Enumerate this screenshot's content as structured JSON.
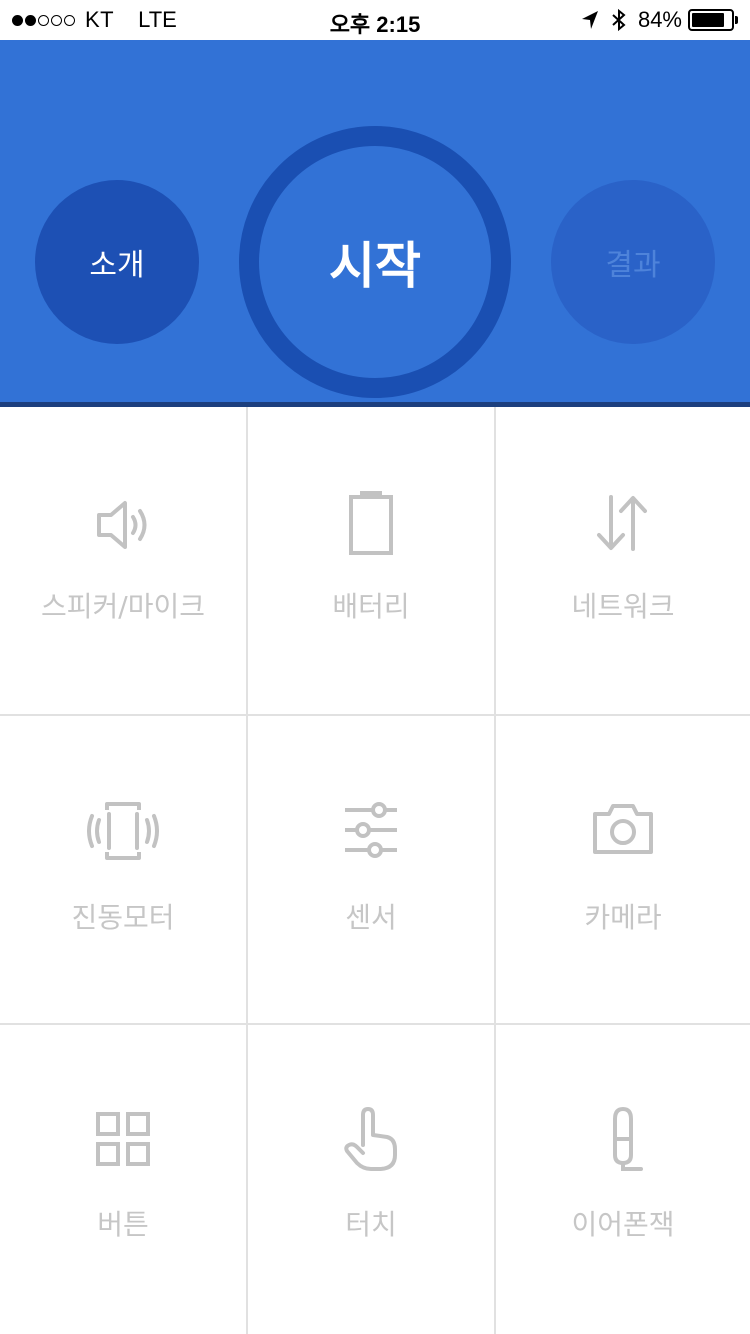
{
  "status_bar": {
    "carrier": "KT",
    "network": "LTE",
    "time": "오후 2:15",
    "battery_percent": "84%",
    "battery_level": 0.84,
    "signal_bars_filled": 2,
    "signal_bars_total": 5,
    "icons": [
      "location-arrow-icon",
      "bluetooth-icon",
      "battery-icon"
    ]
  },
  "header": {
    "colors": {
      "background": "#3272d6",
      "intro_circle": "#1d50b4",
      "start_ring": "#1a4fb2",
      "result_circle": "#2a62c8"
    },
    "intro_label": "소개",
    "start_label": "시작",
    "result_label": "결과"
  },
  "grid": {
    "label_color": "#c6c6c6",
    "items": [
      {
        "label": "스피커/마이크",
        "icon": "speaker-icon"
      },
      {
        "label": "배터리",
        "icon": "battery-icon"
      },
      {
        "label": "네트워크",
        "icon": "network-arrows-icon"
      },
      {
        "label": "진동모터",
        "icon": "vibration-icon"
      },
      {
        "label": "센서",
        "icon": "sliders-icon"
      },
      {
        "label": "카메라",
        "icon": "camera-icon"
      },
      {
        "label": "버튼",
        "icon": "grid-buttons-icon"
      },
      {
        "label": "터치",
        "icon": "touch-hand-icon"
      },
      {
        "label": "이어폰잭",
        "icon": "earphone-jack-icon"
      }
    ]
  }
}
